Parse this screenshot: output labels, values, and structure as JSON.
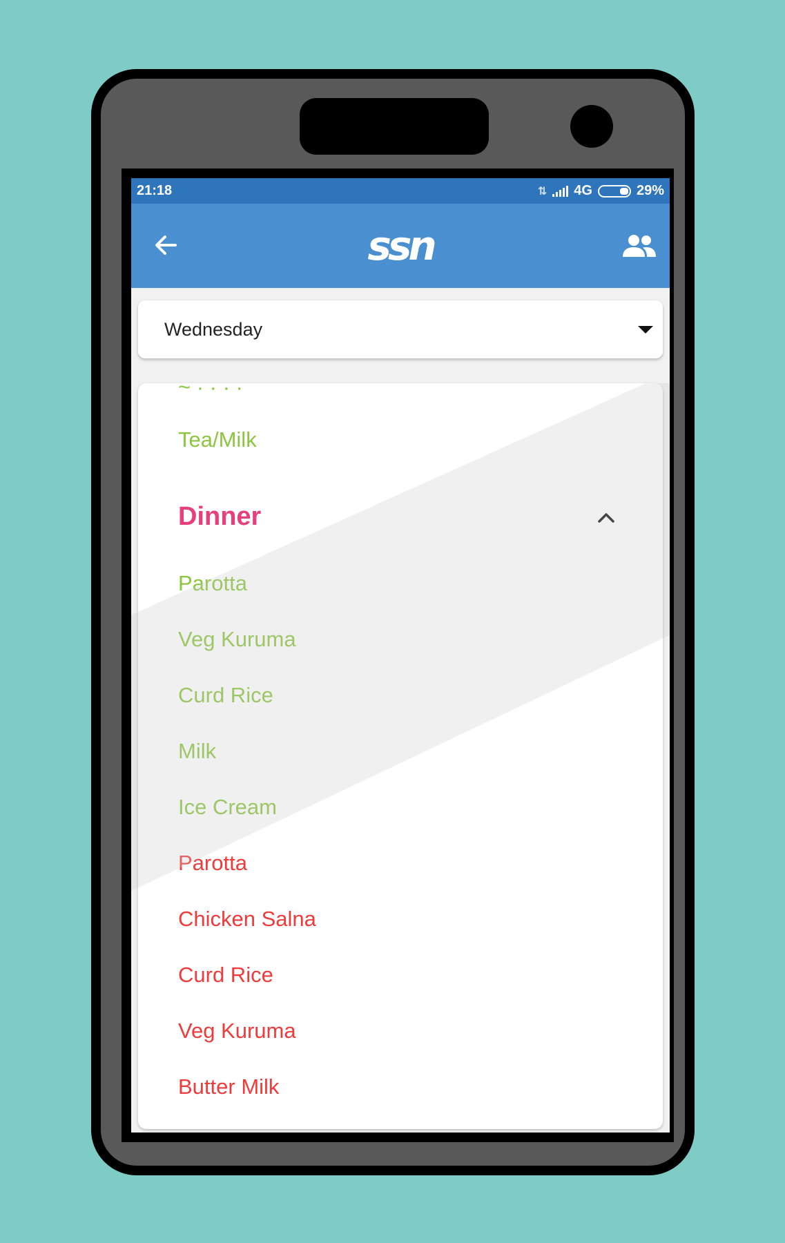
{
  "status_bar": {
    "time": "21:18",
    "network": "4G",
    "battery": "29%"
  },
  "app_bar": {
    "logo": "ssn",
    "back_icon": "arrow-left-icon",
    "profile_icon": "group-icon",
    "color": "#4a8fcf"
  },
  "day_selector": {
    "selected": "Wednesday"
  },
  "menu": {
    "previous_items": [
      "Tea/Milk"
    ],
    "section": {
      "title": "Dinner",
      "expanded": true,
      "veg_items": [
        "Parotta",
        "Veg Kuruma",
        "Curd Rice",
        "Milk",
        "Ice Cream"
      ],
      "nonveg_items": [
        "Parotta",
        "Chicken Salna",
        "Curd Rice",
        "Veg Kuruma",
        "Butter Milk"
      ]
    }
  },
  "colors": {
    "veg": "#8cc63f",
    "nonveg": "#ef3b3b",
    "section_title": "#e5407c",
    "status_bar": "#2e75bc",
    "background": "#7fcbc5"
  }
}
